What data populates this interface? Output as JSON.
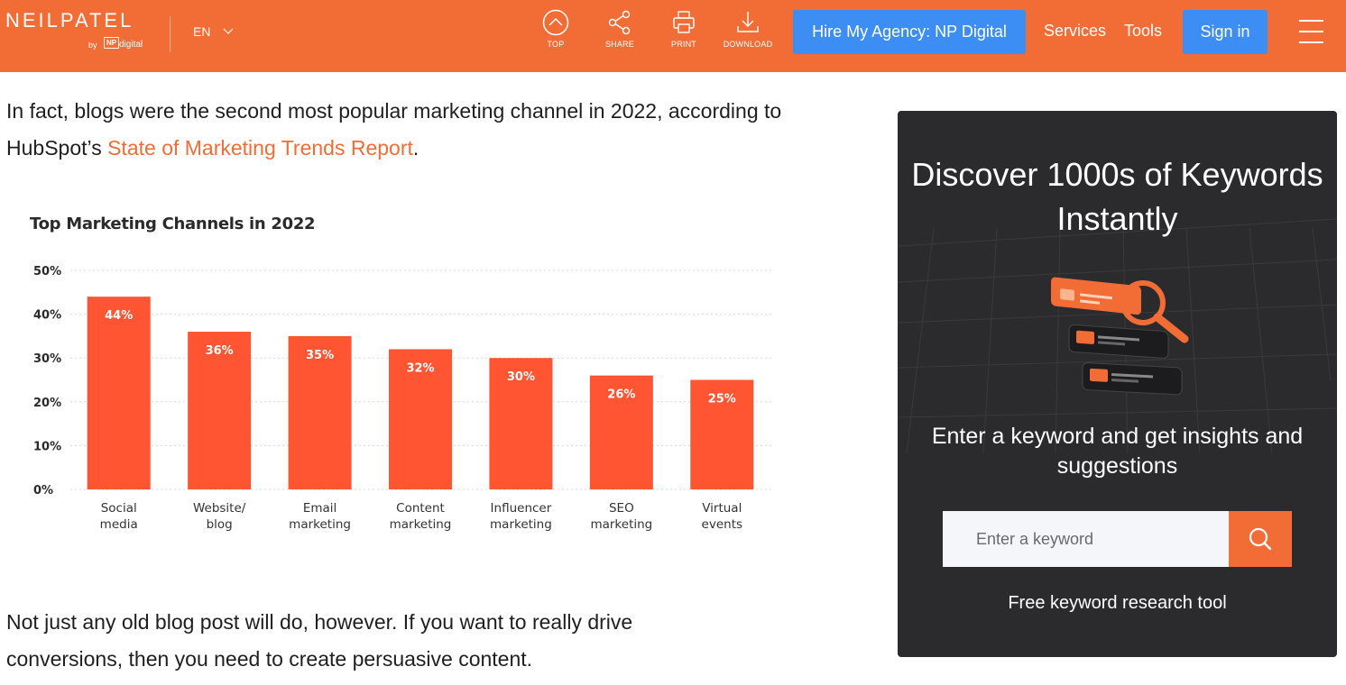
{
  "header": {
    "logo_text": "NEILPATEL",
    "logo_by": "by",
    "logo_np": "NP",
    "logo_digital": "digital",
    "language": "EN",
    "tools": [
      {
        "label": "TOP",
        "icon": "arrow-up-circle-icon"
      },
      {
        "label": "SHARE",
        "icon": "share-icon"
      },
      {
        "label": "PRINT",
        "icon": "print-icon"
      },
      {
        "label": "DOWNLOAD",
        "icon": "download-icon"
      }
    ],
    "hire_label": "Hire My Agency: NP Digital",
    "services_label": "Services",
    "tools_label": "Tools",
    "signin_label": "Sign in"
  },
  "article": {
    "para1_text": "In fact, blogs were the second most popular marketing channel in 2022, according to HubSpot’s ",
    "para1_link": "State of Marketing Trends Report",
    "para1_end": ".",
    "para2_text": "Not just any old blog post will do, however. If you want to really drive conversions, then you need to create persuasive content."
  },
  "chart_data": {
    "type": "bar",
    "title": "Top Marketing Channels in 2022",
    "categories": [
      "Social media",
      "Website/ blog",
      "Email marketing",
      "Content marketing",
      "Influencer marketing",
      "SEO marketing",
      "Virtual events"
    ],
    "category_lines": [
      [
        "Social",
        "media"
      ],
      [
        "Website/",
        "blog"
      ],
      [
        "Email",
        "marketing"
      ],
      [
        "Content",
        "marketing"
      ],
      [
        "Influencer",
        "marketing"
      ],
      [
        "SEO",
        "marketing"
      ],
      [
        "Virtual",
        "events"
      ]
    ],
    "values": [
      44,
      36,
      35,
      32,
      30,
      26,
      25
    ],
    "value_labels": [
      "44%",
      "36%",
      "35%",
      "32%",
      "30%",
      "26%",
      "25%"
    ],
    "yticks": [
      "0%",
      "10%",
      "20%",
      "30%",
      "40%",
      "50%"
    ],
    "ylim": [
      0,
      50
    ],
    "grid": true,
    "bar_color": "#ff5533"
  },
  "widget": {
    "title": "Discover 1000s of Keywords Instantly",
    "subtitle": "Enter a keyword and get insights and suggestions",
    "placeholder": "Enter a keyword",
    "footer": "Free keyword research tool",
    "accent": "#f26d36"
  }
}
